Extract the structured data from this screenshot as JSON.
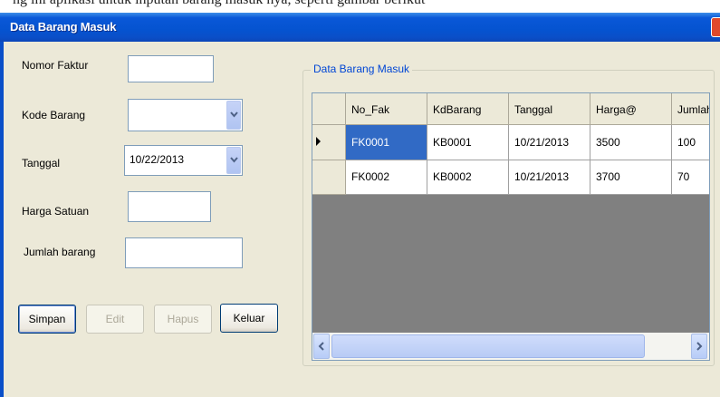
{
  "top_fragment": "ng ini aplikasi untuk inputan barang masuk nya, seperti gambar berikut",
  "window": {
    "title": "Data Barang Masuk"
  },
  "form": {
    "nomor_faktur": {
      "label": "Nomor Faktur",
      "value": ""
    },
    "kode_barang": {
      "label": "Kode  Barang",
      "value": ""
    },
    "tanggal": {
      "label": "Tanggal",
      "value": "10/22/2013"
    },
    "harga_satuan": {
      "label": "Harga Satuan",
      "value": ""
    },
    "jumlah_barang": {
      "label": "Jumlah barang",
      "value": ""
    }
  },
  "buttons": {
    "simpan": {
      "label": "Simpan",
      "enabled": true
    },
    "edit": {
      "label": "Edit",
      "enabled": false
    },
    "hapus": {
      "label": "Hapus",
      "enabled": false
    },
    "keluar": {
      "label": "Keluar",
      "enabled": true
    }
  },
  "group": {
    "title": "Data Barang Masuk"
  },
  "grid": {
    "columns": [
      "No_Fak",
      "KdBarang",
      "Tanggal",
      "Harga@",
      "Jumlah"
    ],
    "rows": [
      [
        "FK0001",
        "KB0001",
        "10/21/2013",
        "3500",
        "100"
      ],
      [
        "FK0002",
        "KB0002",
        "10/21/2013",
        "3700",
        "70"
      ]
    ],
    "selected_row": 0
  },
  "colors": {
    "title_bar": "#0553d0",
    "selection": "#316ac5",
    "grid_background": "#808080",
    "group_title": "#0046d5"
  },
  "icons": [
    "dropdown-arrow-icon",
    "row-pointer-icon",
    "scroll-left-icon",
    "scroll-right-icon",
    "close-icon"
  ]
}
